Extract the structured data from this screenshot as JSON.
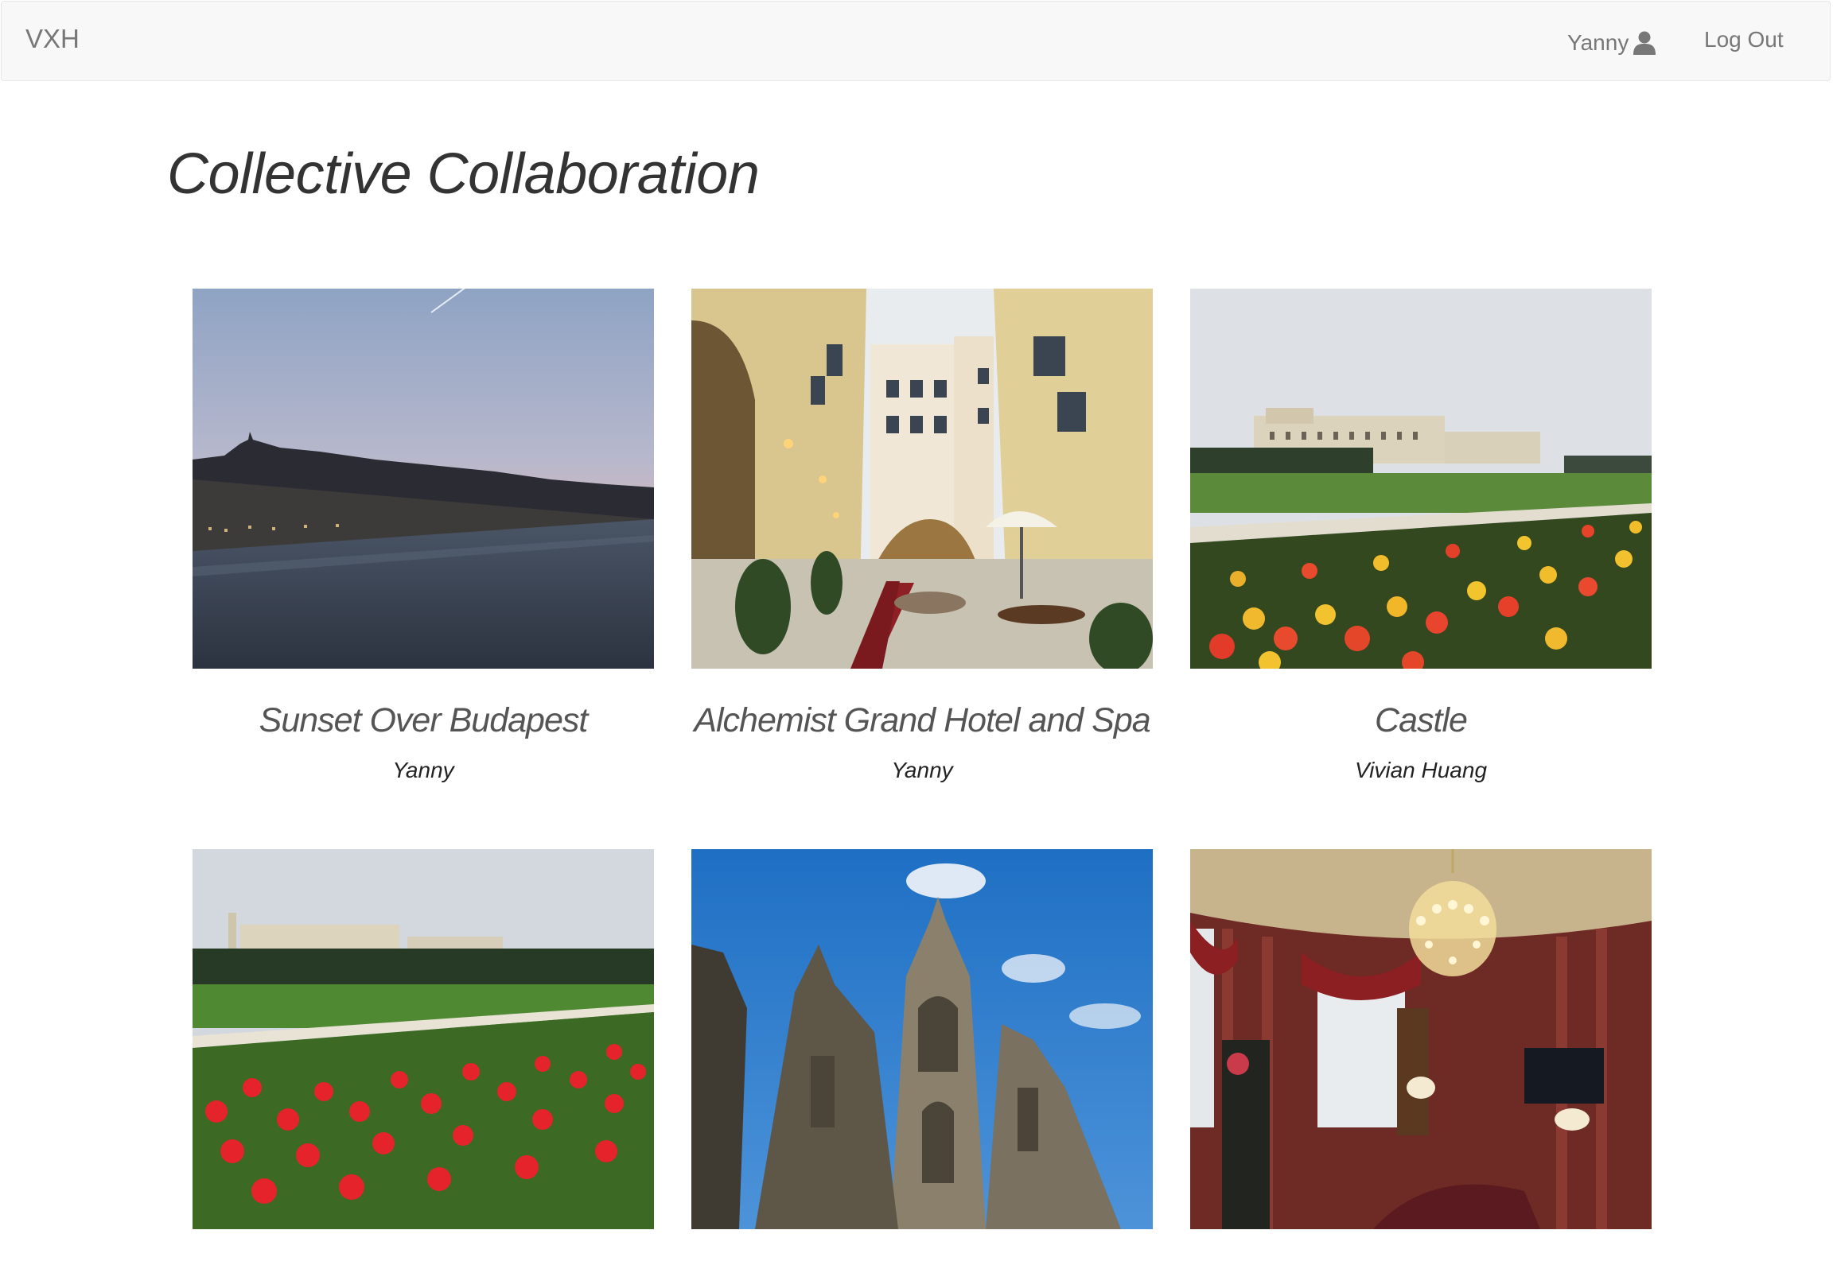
{
  "navbar": {
    "brand": "VXH",
    "user_name": "Yanny",
    "user_icon": "user-icon",
    "logout_label": "Log Out"
  },
  "page": {
    "title": "Collective Collaboration"
  },
  "gallery": {
    "items": [
      {
        "title": "Sunset Over Budapest",
        "author": "Yanny"
      },
      {
        "title": "Alchemist Grand Hotel and Spa",
        "author": "Yanny"
      },
      {
        "title": "Castle",
        "author": "Vivian Huang"
      },
      {
        "title": "",
        "author": ""
      },
      {
        "title": "",
        "author": ""
      },
      {
        "title": "",
        "author": ""
      }
    ]
  },
  "colors": {
    "navbar_bg": "#f8f8f8",
    "navbar_text": "#777777",
    "title_text": "#333333"
  }
}
